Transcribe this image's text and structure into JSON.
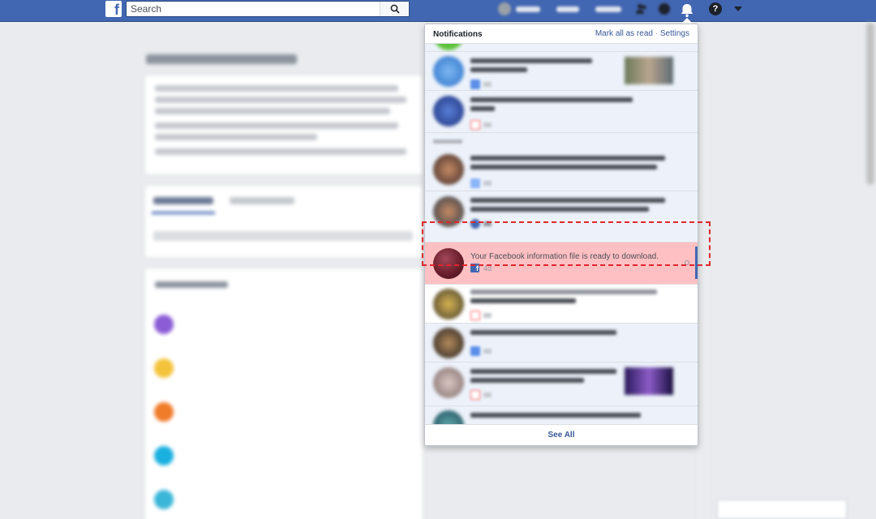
{
  "search": {
    "placeholder": "Search"
  },
  "notifications": {
    "title": "Notifications",
    "mark_all_read": "Mark all as read",
    "separator": "·",
    "settings": "Settings",
    "highlighted": {
      "text": "Your Facebook information file is ready to download.",
      "time": "4d"
    },
    "see_all": "See All"
  },
  "colors": {
    "topbar": "#4267b2",
    "highlight_bg": "#ffc0c3",
    "highlight_border": "#e0262d",
    "link": "#385898"
  },
  "icons": [
    "facebook-logo-icon",
    "search-icon",
    "bell-icon",
    "help-icon",
    "caret-down-icon",
    "facebook-small-icon"
  ]
}
